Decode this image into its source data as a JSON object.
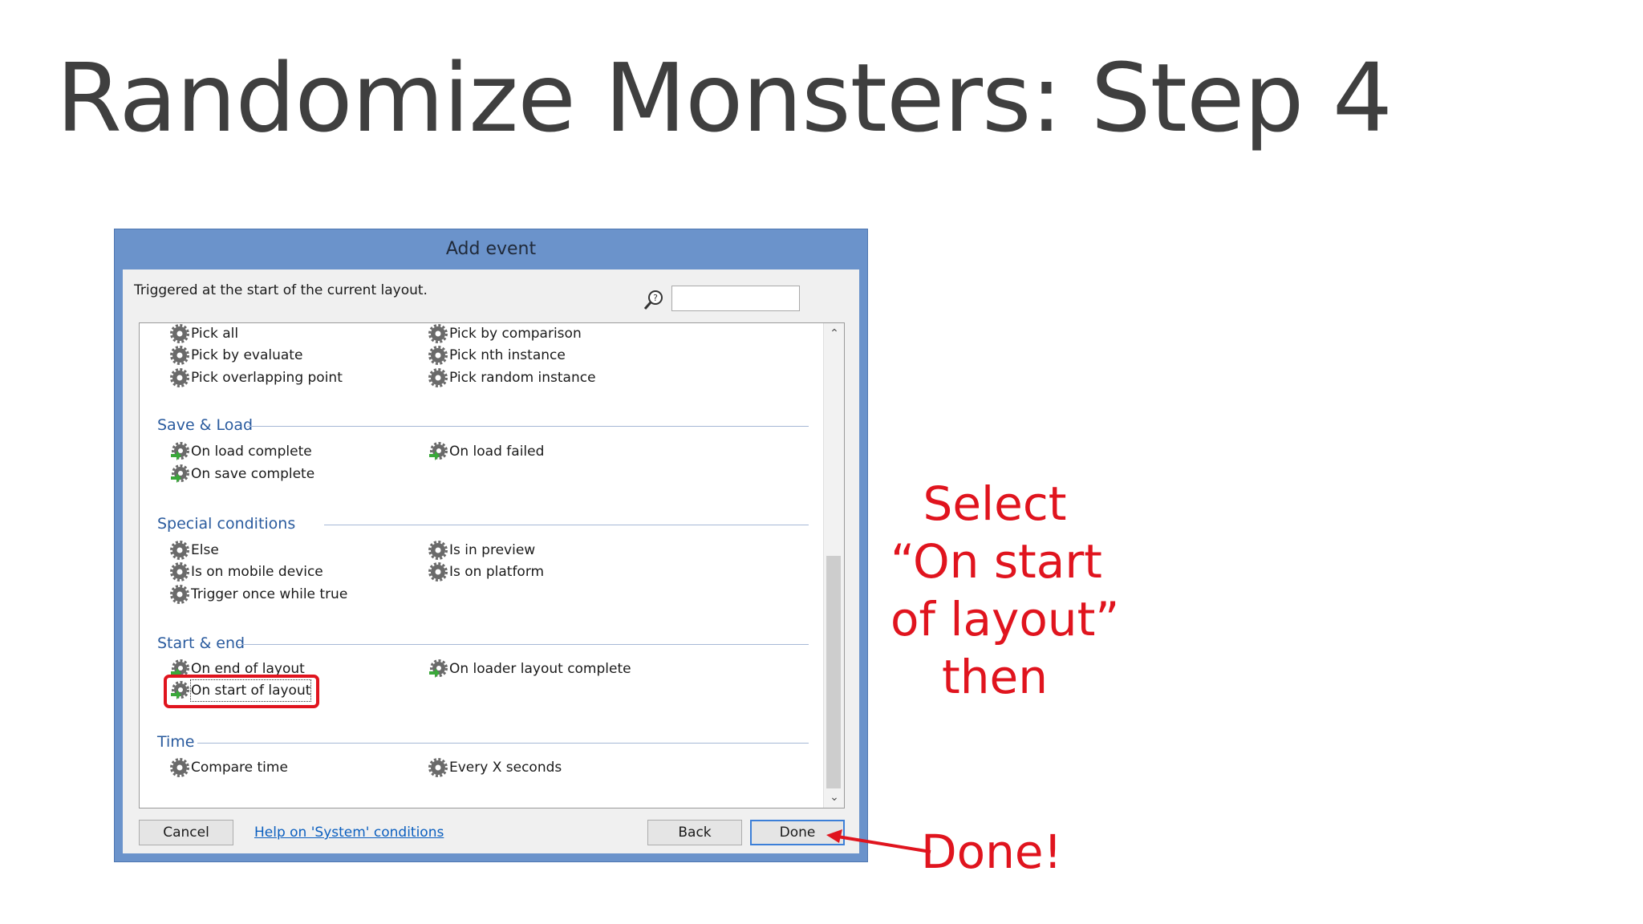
{
  "slide": {
    "title": "Randomize Monsters: Step 4"
  },
  "dialog": {
    "title": "Add event",
    "description": "Triggered at the start of the current layout.",
    "search": {
      "value": "",
      "placeholder": ""
    },
    "sections": [
      {
        "name": "",
        "items": [
          "Pick all",
          "Pick by comparison",
          "Pick by evaluate",
          "Pick nth instance",
          "Pick overlapping point",
          "Pick random instance"
        ]
      },
      {
        "name": "Save & Load",
        "items": [
          "On load complete",
          "On load failed",
          "On save complete"
        ]
      },
      {
        "name": "Special conditions",
        "items": [
          "Else",
          "Is in preview",
          "Is on mobile device",
          "Is on platform",
          "Trigger once while true"
        ]
      },
      {
        "name": "Start & end",
        "items": [
          "On end of layout",
          "On loader layout complete",
          "On start of layout"
        ]
      },
      {
        "name": "Time",
        "items": [
          "Compare time",
          "Every X seconds"
        ]
      }
    ],
    "selected_item": "On start of layout",
    "buttons": {
      "cancel": "Cancel",
      "back": "Back",
      "done": "Done"
    },
    "help_link": "Help on 'System' conditions"
  },
  "annotations": {
    "select_lines": [
      "Select",
      "“On start",
      "of layout”",
      "then"
    ],
    "done": "Done!"
  },
  "colors": {
    "annotation": "#e0141e",
    "dialog_frame": "#6b93cb",
    "section_header": "#2a5b9e"
  },
  "icons": {
    "condition": "gear-icon",
    "trigger": "gear-arrow-icon",
    "search": "search-help-icon"
  }
}
